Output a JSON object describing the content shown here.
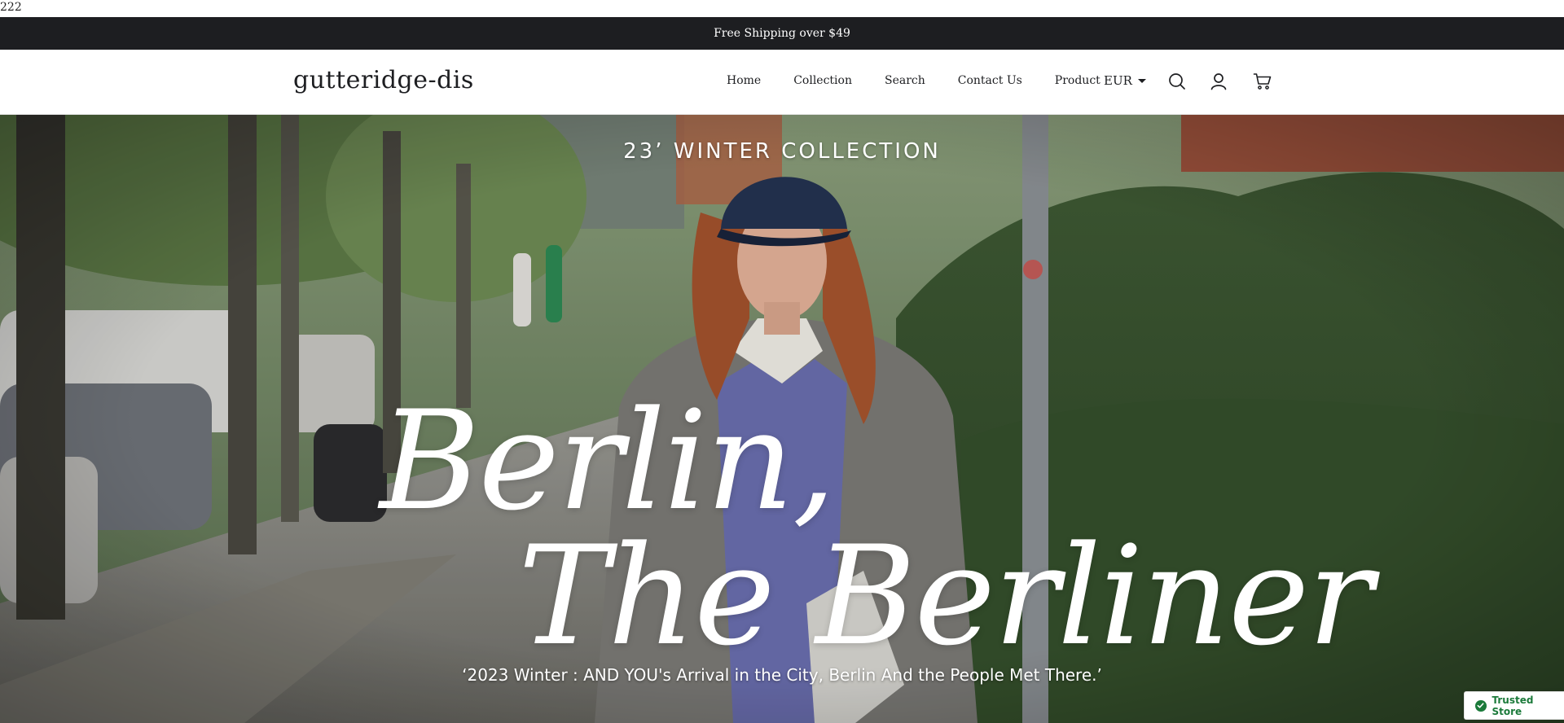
{
  "debug": {
    "text": "222"
  },
  "announcement": {
    "text": "Free Shipping over $49"
  },
  "header": {
    "logo": "gutteridge-dis",
    "nav": [
      "Home",
      "Collection",
      "Search",
      "Contact Us",
      "Product"
    ],
    "currency": "EUR",
    "icons": [
      "search-icon",
      "account-icon",
      "cart-icon"
    ]
  },
  "hero": {
    "eyebrow": "23’ WINTER COLLECTION",
    "headline_line1": "Berlin,",
    "headline_line2": "The Berliner",
    "subtitle": "‘2023  Winter : AND YOU's Arrival in the City, Berlin And the People Met There.’"
  },
  "badge": {
    "label": "Trusted Store",
    "icon": "shield-check-icon"
  },
  "colors": {
    "announcement_bg": "#1d1e21",
    "trusted_green": "#1b7a3a"
  }
}
